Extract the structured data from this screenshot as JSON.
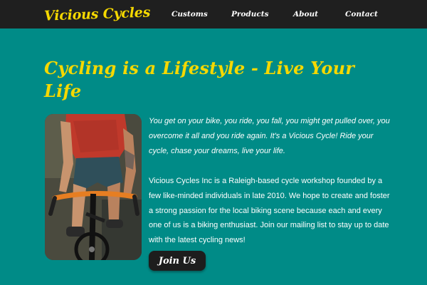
{
  "nav": {
    "logo": "Vicious Cycles",
    "links": [
      "Customs",
      "Products",
      "About",
      "Contact"
    ]
  },
  "hero": {
    "headline": "Cycling is a Lifestyle - Live Your Life",
    "intro": "You get on your bike, you ride, you fall, you might get pulled over, you overcome it all and you ride again. It's a Vicious Cycle! Ride your cycle, chase your dreams, live your life.",
    "about": "Vicious Cycles Inc is a Raleigh-based cycle workshop founded by a few like-minded individuals in late 2010. We hope to create and foster a strong passion for the local biking scene because each and every one of us is a biking enthusiast. Join our mailing list to stay up to date with the latest cycling news!",
    "cta": "Join Us"
  },
  "colors": {
    "background": "#008b87",
    "navbar": "#1f1f1f",
    "accent": "#f5d800",
    "button": "#1d1d1d"
  }
}
